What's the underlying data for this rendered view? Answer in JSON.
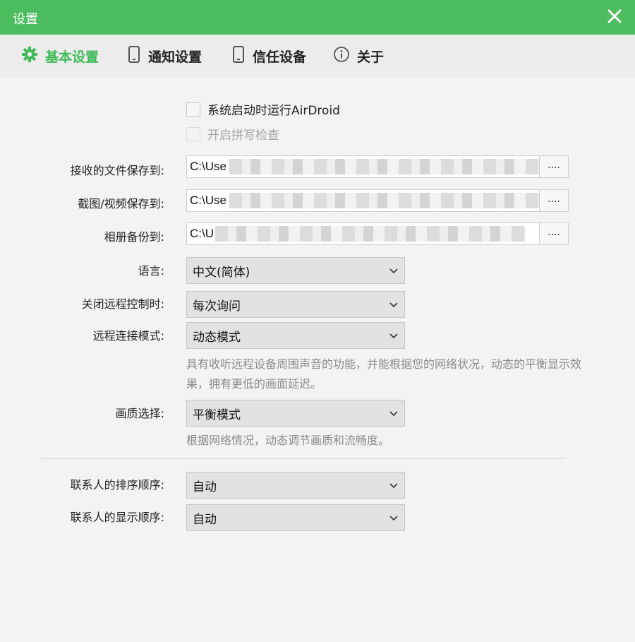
{
  "window": {
    "title": "设置"
  },
  "tabs": [
    {
      "label": "基本设置",
      "icon": "gear-icon",
      "active": true
    },
    {
      "label": "通知设置",
      "icon": "phone-icon",
      "active": false
    },
    {
      "label": "信任设备",
      "icon": "phone-icon",
      "active": false
    },
    {
      "label": "关于",
      "icon": "info-icon",
      "active": false
    }
  ],
  "checkboxes": {
    "autostart": {
      "label": "系统启动时运行AirDroid",
      "checked": false,
      "enabled": true
    },
    "spellcheck": {
      "label": "开启拼写检查",
      "checked": false,
      "enabled": false
    }
  },
  "paths": {
    "received_files": {
      "label": "接收的文件保存到:",
      "value": "C:\\Use",
      "browse": "...."
    },
    "screenshots": {
      "label": "截图/视频保存到:",
      "value": "C:\\Use",
      "browse": "...."
    },
    "album_backup": {
      "label": "相册备份到:",
      "value": "C:\\U",
      "browse": "...."
    }
  },
  "selects": {
    "language": {
      "label": "语言:",
      "value": "中文(简体)"
    },
    "close_remote": {
      "label": "关闭远程控制时:",
      "value": "每次询问"
    },
    "remote_mode": {
      "label": "远程连接模式:",
      "value": "动态模式"
    },
    "quality": {
      "label": "画质选择:",
      "value": "平衡模式"
    },
    "contact_sort": {
      "label": "联系人的排序顺序:",
      "value": "自动"
    },
    "contact_display": {
      "label": "联系人的显示顺序:",
      "value": "自动"
    }
  },
  "hints": {
    "remote_mode": "具有收听远程设备周围声音的功能，并能根据您的网络状况，动态的平衡显示效果，拥有更低的画面延迟。",
    "quality": "根据网络情况，动态调节画质和流畅度。"
  },
  "colors": {
    "accent": "#4cbd5f",
    "active_tab": "#3fba57"
  }
}
